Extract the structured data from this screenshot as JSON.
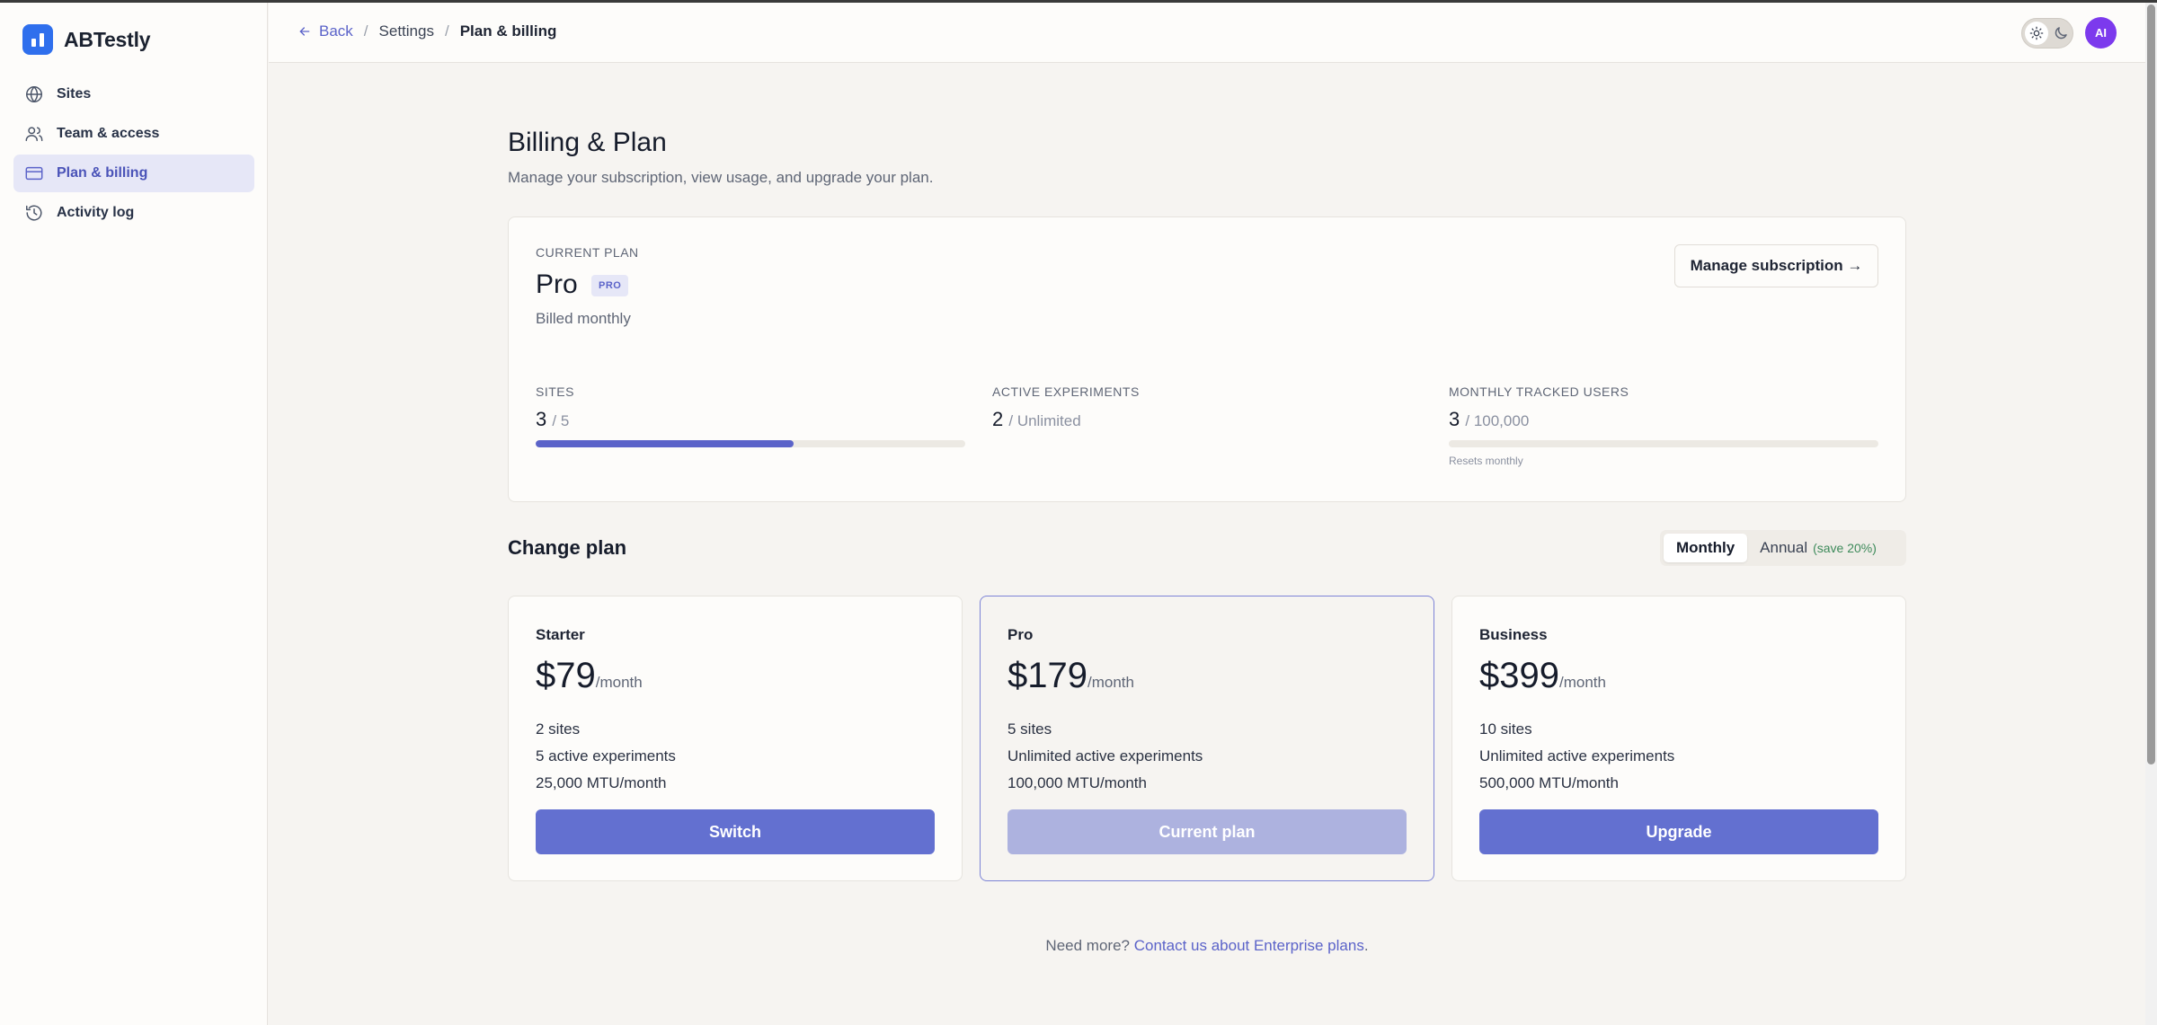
{
  "app": {
    "name": "ABTestly"
  },
  "sidebar": {
    "items": [
      {
        "label": "Sites",
        "icon": "globe-icon",
        "active": false
      },
      {
        "label": "Team & access",
        "icon": "users-icon",
        "active": false
      },
      {
        "label": "Plan & billing",
        "icon": "credit-card-icon",
        "active": true
      },
      {
        "label": "Activity log",
        "icon": "history-icon",
        "active": false
      }
    ]
  },
  "header": {
    "back_label": "Back",
    "breadcrumb_settings": "Settings",
    "breadcrumb_current": "Plan & billing",
    "avatar_initials": "AI"
  },
  "page": {
    "title": "Billing & Plan",
    "subtitle": "Manage your subscription, view usage, and upgrade your plan."
  },
  "current_plan": {
    "label": "CURRENT PLAN",
    "name": "Pro",
    "badge": "PRO",
    "billing": "Billed monthly",
    "manage_label": "Manage subscription →"
  },
  "usage": [
    {
      "label": "SITES",
      "value": "3",
      "limit": "/ 5",
      "fraction": 0.6,
      "note": ""
    },
    {
      "label": "ACTIVE EXPERIMENTS",
      "value": "2",
      "limit": "/ Unlimited",
      "fraction": null,
      "note": ""
    },
    {
      "label": "MONTHLY TRACKED USERS",
      "value": "3",
      "limit": "/ 100,000",
      "fraction": 3e-05,
      "note": "Resets monthly"
    }
  ],
  "change_plan": {
    "title": "Change plan",
    "monthly_label": "Monthly",
    "annual_label": "Annual",
    "annual_save": "(save 20%)",
    "selected": "monthly"
  },
  "tiers": [
    {
      "name": "Starter",
      "price": "$79",
      "per": "/month",
      "features": [
        "2 sites",
        "5 active experiments",
        "25,000 MTU/month"
      ],
      "button": "Switch",
      "current": false
    },
    {
      "name": "Pro",
      "price": "$179",
      "per": "/month",
      "features": [
        "5 sites",
        "Unlimited active experiments",
        "100,000 MTU/month"
      ],
      "button": "Current plan",
      "current": true
    },
    {
      "name": "Business",
      "price": "$399",
      "per": "/month",
      "features": [
        "10 sites",
        "Unlimited active experiments",
        "500,000 MTU/month"
      ],
      "button": "Upgrade",
      "current": false
    }
  ],
  "footer": {
    "prefix": "Need more?",
    "link": "Contact us about Enterprise plans",
    "suffix": "."
  },
  "colors": {
    "accent": "#5b63c9",
    "brand": "#2f6fed",
    "avatar": "#7c3aed",
    "button": "#6370d0"
  }
}
